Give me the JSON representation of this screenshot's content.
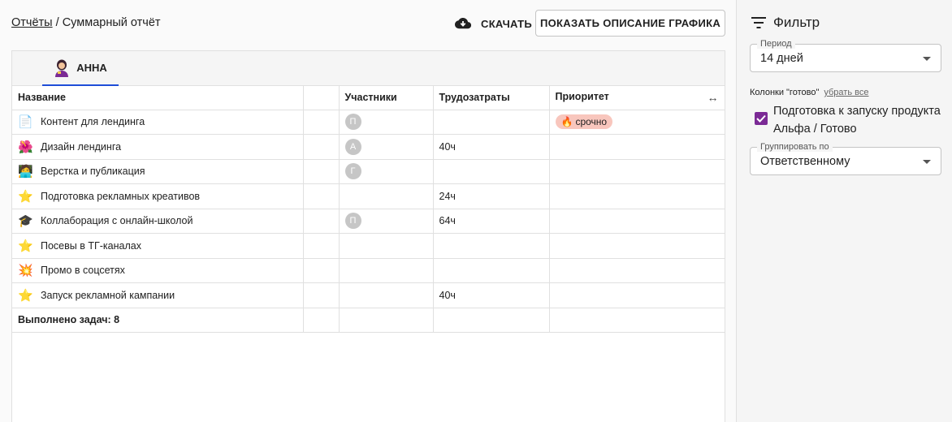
{
  "breadcrumb": {
    "link": "Отчёты",
    "separator": " / ",
    "current": "Суммарный отчёт"
  },
  "toolbar": {
    "download_label": "СКАЧАТЬ",
    "show_description_label": "ПОКАЗАТЬ ОПИСАНИЕ ГРАФИКА"
  },
  "tabs": [
    {
      "label": "АННА",
      "active": true
    }
  ],
  "table": {
    "columns": [
      "Название",
      "",
      "Участники",
      "Трудозатраты",
      "Приоритет"
    ],
    "rows": [
      {
        "icon": "document-icon",
        "name": "Контент для лендинга",
        "participant": "П",
        "effort": "",
        "priority": "срочно"
      },
      {
        "icon": "hibiscus-icon",
        "name": "Дизайн лендинга",
        "participant": "А",
        "effort": "40ч",
        "priority": ""
      },
      {
        "icon": "technologist-icon",
        "name": "Верстка и публикация",
        "participant": "Г",
        "effort": "",
        "priority": ""
      },
      {
        "icon": "star-icon",
        "name": "Подготовка рекламных креативов",
        "participant": "",
        "effort": "24ч",
        "priority": ""
      },
      {
        "icon": "graduation-cap-icon",
        "name": "Коллаборация с онлайн-школой",
        "participant": "П",
        "effort": "64ч",
        "priority": ""
      },
      {
        "icon": "star-icon",
        "name": "Посевы в ТГ-каналах",
        "participant": "",
        "effort": "",
        "priority": ""
      },
      {
        "icon": "collision-icon",
        "name": "Промо в соцсетях",
        "participant": "",
        "effort": "",
        "priority": ""
      },
      {
        "icon": "star-icon",
        "name": "Запуск рекламной кампании",
        "participant": "",
        "effort": "40ч",
        "priority": ""
      }
    ],
    "footer": "Выполнено задач: 8"
  },
  "sidebar": {
    "title": "Фильтр",
    "period": {
      "legend": "Период",
      "value": "14 дней"
    },
    "done_columns": {
      "label": "Колонки \"готово\"",
      "clear_label": "убрать все"
    },
    "checkbox": {
      "label": "Подготовка к запуску продукта Альфа / Готово",
      "checked": true
    },
    "group_by": {
      "legend": "Группировать по",
      "value": "Ответственному"
    }
  },
  "colors": {
    "accent": "#1e4dd8",
    "checkbox": "#7b2a95",
    "priority_bg": "#f8c6bd"
  }
}
